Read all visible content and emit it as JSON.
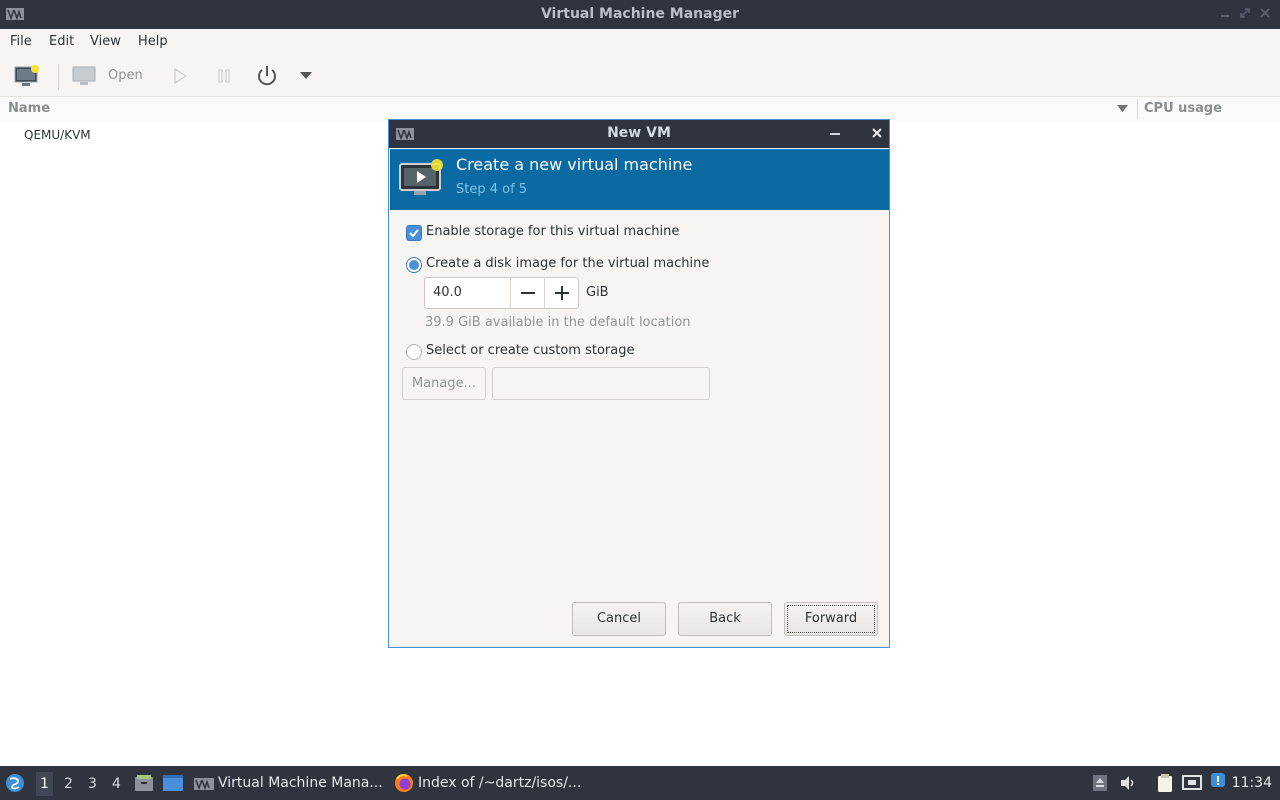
{
  "window": {
    "title": "Virtual Machine Manager",
    "logo": "vm-logo-icon",
    "controls": [
      "minimize-icon",
      "maximize-icon",
      "close-icon"
    ]
  },
  "menu": [
    "File",
    "Edit",
    "View",
    "Help"
  ],
  "toolbar": {
    "new_icon": "new-vm-icon",
    "open_label": "Open",
    "run_icon": "play-icon",
    "pause_icon": "pause-icon",
    "power_icon": "power-icon",
    "dropdown_icon": "chevron-down-icon"
  },
  "list": {
    "columns": {
      "name": "Name",
      "cpu": "CPU usage"
    },
    "rows": [
      {
        "name": "QEMU/KVM"
      }
    ]
  },
  "dialog": {
    "title": "New VM",
    "banner_title": "Create a new virtual machine",
    "banner_step": "Step 4 of 5",
    "enable_storage_label": "Enable storage for this virtual machine",
    "enable_storage_checked": true,
    "create_disk_label": "Create a disk image for the virtual machine",
    "disk_size": "40.0",
    "disk_unit": "GiB",
    "available_hint": "39.9 GiB available in the default location",
    "custom_storage_label": "Select or create custom storage",
    "selected_option": "create_disk",
    "manage_label": "Manage...",
    "custom_path": "",
    "cancel_label": "Cancel",
    "back_label": "Back",
    "forward_label": "Forward"
  },
  "taskbar": {
    "workspaces": [
      "1",
      "2",
      "3",
      "4"
    ],
    "active_workspace": "1",
    "tasks": [
      {
        "label": "Virtual Machine Mana...",
        "icon": "vm-logo-icon"
      },
      {
        "label": "Index of /~dartz/isos/...",
        "icon": "firefox-icon"
      }
    ],
    "clock": "11:34"
  },
  "colors": {
    "titlebar_bg": "#2f343f",
    "banner_bg": "#0b6aa2",
    "accent": "#4a90d9"
  }
}
